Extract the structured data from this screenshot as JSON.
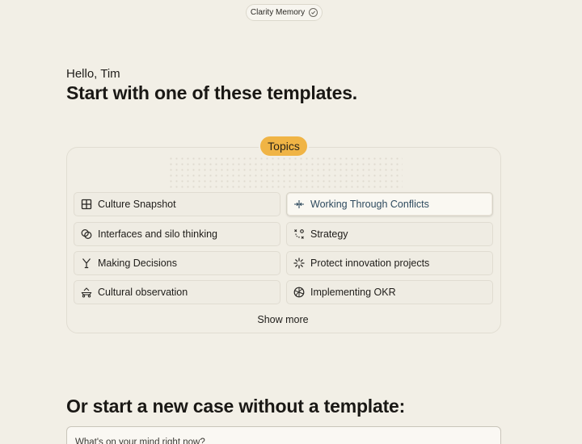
{
  "header": {
    "app_name": "Clarity Memory"
  },
  "hero": {
    "greeting": "Hello, Tim",
    "headline": "Start with one of these templates."
  },
  "topics": {
    "badge": "Topics",
    "items": [
      {
        "label": "Culture Snapshot",
        "icon": "grid-icon"
      },
      {
        "label": "Working Through Conflicts",
        "icon": "arrows-inward-icon",
        "active": true
      },
      {
        "label": "Interfaces and silo thinking",
        "icon": "overlap-circles-icon"
      },
      {
        "label": "Strategy",
        "icon": "strategy-icon"
      },
      {
        "label": "Making Decisions",
        "icon": "fork-icon"
      },
      {
        "label": "Protect innovation projects",
        "icon": "spark-icon"
      },
      {
        "label": "Cultural observation",
        "icon": "boat-icon"
      },
      {
        "label": "Implementing OKR",
        "icon": "target-icon"
      }
    ],
    "show_more": "Show more"
  },
  "new_case": {
    "heading": "Or start a new case without a template:",
    "placeholder": "What's on your mind right now?"
  }
}
